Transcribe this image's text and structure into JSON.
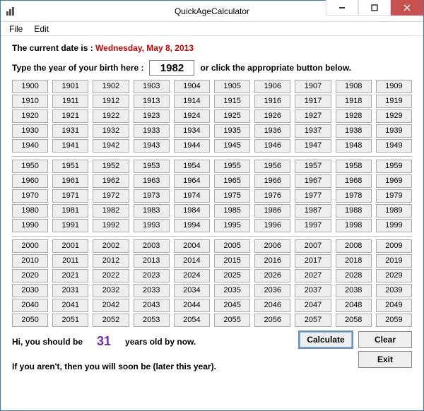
{
  "window": {
    "title": "QuickAgeCalculator"
  },
  "menu": {
    "file": "File",
    "edit": "Edit"
  },
  "labels": {
    "current_date_prefix": "The current date is :  ",
    "current_date": "Wednesday, May 8, 2013",
    "type_year": "Type the year of your birth here :",
    "or_click": "or click the appropriate button below.",
    "hi_prefix": "Hi, you should be",
    "years_suffix": "years old by now.",
    "later_line": "If you aren't, then you will soon be (later this year)."
  },
  "input": {
    "year_value": "1982"
  },
  "result": {
    "age": "31"
  },
  "buttons": {
    "calculate": "Calculate",
    "clear": "Clear",
    "exit": "Exit"
  },
  "year_blocks": [
    [
      1900,
      1901,
      1902,
      1903,
      1904,
      1905,
      1906,
      1907,
      1908,
      1909,
      1910,
      1911,
      1912,
      1913,
      1914,
      1915,
      1916,
      1917,
      1918,
      1919,
      1920,
      1921,
      1922,
      1923,
      1924,
      1925,
      1926,
      1927,
      1928,
      1929,
      1930,
      1931,
      1932,
      1933,
      1934,
      1935,
      1936,
      1937,
      1938,
      1939,
      1940,
      1941,
      1942,
      1943,
      1944,
      1945,
      1946,
      1947,
      1948,
      1949
    ],
    [
      1950,
      1951,
      1952,
      1953,
      1954,
      1955,
      1956,
      1957,
      1958,
      1959,
      1960,
      1961,
      1962,
      1963,
      1964,
      1965,
      1966,
      1967,
      1968,
      1969,
      1970,
      1971,
      1972,
      1973,
      1974,
      1975,
      1976,
      1977,
      1978,
      1979,
      1980,
      1981,
      1982,
      1983,
      1984,
      1985,
      1986,
      1987,
      1988,
      1989,
      1990,
      1991,
      1992,
      1993,
      1994,
      1995,
      1996,
      1997,
      1998,
      1999
    ],
    [
      2000,
      2001,
      2002,
      2003,
      2004,
      2005,
      2006,
      2007,
      2008,
      2009,
      2010,
      2011,
      2012,
      2013,
      2014,
      2015,
      2016,
      2017,
      2018,
      2019,
      2020,
      2021,
      2022,
      2023,
      2024,
      2025,
      2026,
      2027,
      2028,
      2029,
      2030,
      2031,
      2032,
      2033,
      2034,
      2035,
      2036,
      2037,
      2038,
      2039,
      2040,
      2041,
      2042,
      2043,
      2044,
      2045,
      2046,
      2047,
      2048,
      2049,
      2050,
      2051,
      2052,
      2053,
      2054,
      2055,
      2056,
      2057,
      2058,
      2059
    ]
  ]
}
